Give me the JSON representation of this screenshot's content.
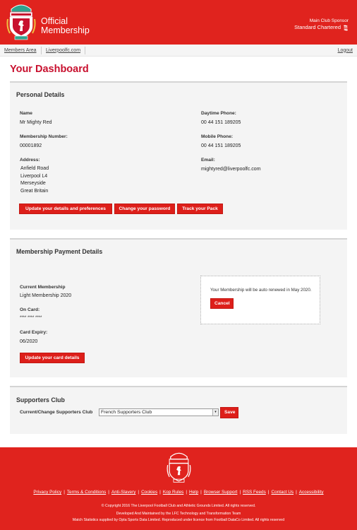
{
  "header": {
    "brand_line1": "Official",
    "brand_line2": "Membership",
    "sponsor_label": "Main Club Sponsor",
    "sponsor_name": "Standard Chartered",
    "logo_icon": "lfc-crest-icon",
    "sponsor_icon": "standard-chartered-icon",
    "colors": {
      "brand_red": "#e0231e",
      "title_red": "#c8102e"
    }
  },
  "nav": {
    "links": [
      "Members Area",
      "Liverpoolfc.com"
    ],
    "logout": "Logout"
  },
  "page_title": "Your Dashboard",
  "personal": {
    "heading": "Personal Details",
    "name_label": "Name",
    "name": "Mr Mighty Red",
    "number_label": "Membership Number:",
    "number": "00001892",
    "address_label": "Address:",
    "address": [
      "Anfield Road",
      "Liverpool L4",
      "Merseyside",
      "Great Britain"
    ],
    "daytime_label": "Daytime Phone:",
    "daytime": "00 44 151 189205",
    "mobile_label": "Mobile Phone:",
    "mobile": "00 44 151 189205",
    "email_label": "Email:",
    "email": "mightyred@liverpoolfc.com",
    "buttons": [
      "Update your details and preferences",
      "Change your password",
      "Track your Pack"
    ]
  },
  "payment": {
    "heading": "Membership Payment Details",
    "current_label": "Current Membership",
    "current": "Light Membership 2020",
    "card_label": "On Card:",
    "card": "**** **** ****",
    "expiry_label": "Card Expiry:",
    "expiry": "06/2020",
    "update_button": "Update your card details",
    "notice": "Your Membership will be auto renewed in May 2020.",
    "cancel_button": "Cancel"
  },
  "supporters": {
    "heading": "Supporters Club",
    "select_label": "Current/Change Supporters Club",
    "selected": "French Supporters Club",
    "save_button": "Save"
  },
  "footer": {
    "links": [
      "Privacy Policy",
      "Terms & Conditions",
      "Anti-Slavery",
      "Cookies",
      "Kop Rules",
      "Help",
      "Browser Support",
      "RSS Feeds",
      "Contact Us",
      "Accessibility"
    ],
    "separator": "|",
    "copyright": "© Copyright 2016 The Liverpool Football Club and Athletic Grounds Limited. All rights reserved.",
    "developed": "Developed And Maintained by the LFC Technology and Transformation Team",
    "stats": "Match Statistics supplied by Opta Sports Data Limited. Reproduced under licence from Football DataCo Limited. All rights reserved"
  }
}
